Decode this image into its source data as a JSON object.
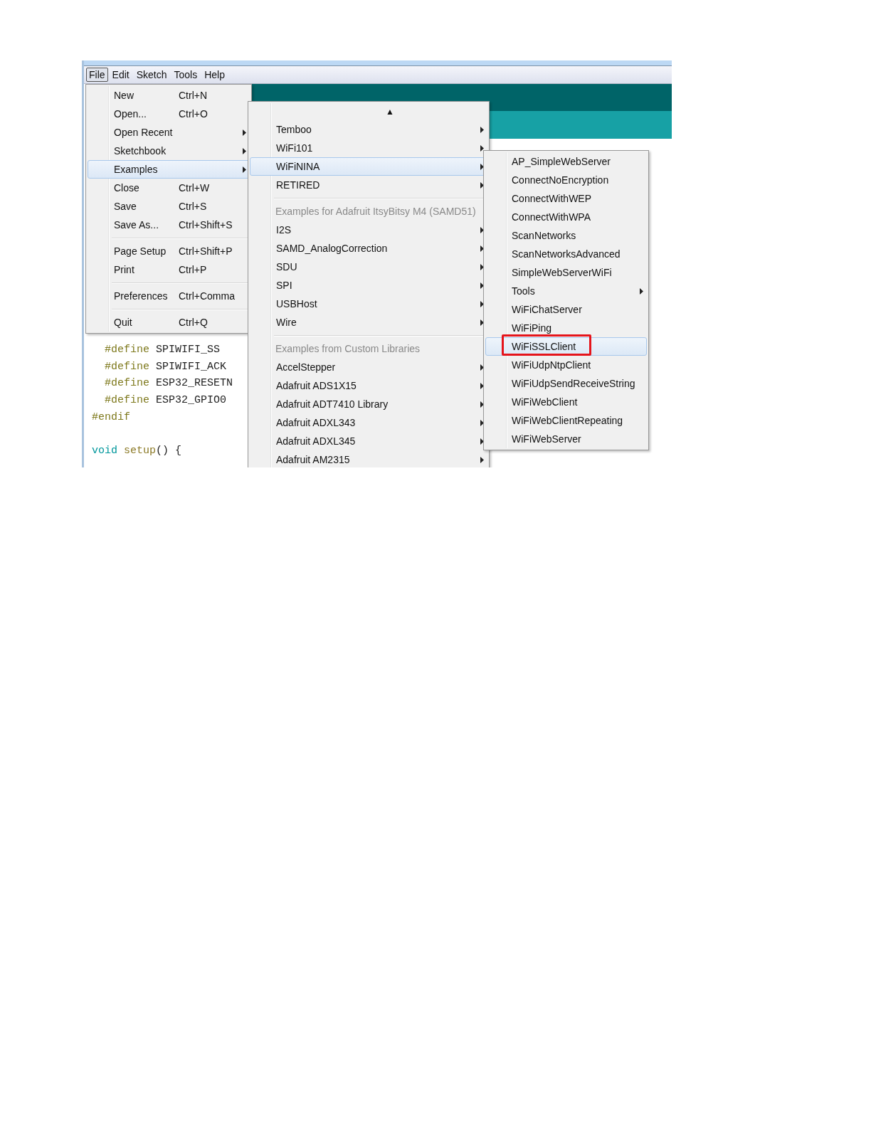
{
  "menu_bar": [
    {
      "label": "File",
      "selected": true
    },
    {
      "label": "Edit",
      "selected": false
    },
    {
      "label": "Sketch",
      "selected": false
    },
    {
      "label": "Tools",
      "selected": false
    },
    {
      "label": "Help",
      "selected": false
    }
  ],
  "code_lines": [
    {
      "tokens": [
        {
          "text": "  #define",
          "kind": "directive"
        },
        {
          "text": " SPIWIFI_SS",
          "kind": "plain"
        }
      ]
    },
    {
      "tokens": [
        {
          "text": "  #define",
          "kind": "directive"
        },
        {
          "text": " SPIWIFI_ACK",
          "kind": "plain"
        }
      ]
    },
    {
      "tokens": [
        {
          "text": "  #define",
          "kind": "directive"
        },
        {
          "text": " ESP32_RESETN",
          "kind": "plain"
        }
      ]
    },
    {
      "tokens": [
        {
          "text": "  #define",
          "kind": "directive"
        },
        {
          "text": " ESP32_GPIO0",
          "kind": "plain"
        }
      ]
    },
    {
      "tokens": [
        {
          "text": "#endif",
          "kind": "directive"
        }
      ]
    },
    {
      "kind": "blank"
    },
    {
      "tokens": [
        {
          "text": "void",
          "kind": "type"
        },
        {
          "text": " setup",
          "kind": "function"
        },
        {
          "text": "() {",
          "kind": "plain"
        }
      ]
    }
  ],
  "file_menu": [
    {
      "kind": "item",
      "label": "New",
      "shortcut": "Ctrl+N",
      "has_submenu": false,
      "selected": false
    },
    {
      "kind": "item",
      "label": "Open...",
      "shortcut": "Ctrl+O",
      "has_submenu": false,
      "selected": false
    },
    {
      "kind": "item",
      "label": "Open Recent",
      "has_submenu": true,
      "selected": false
    },
    {
      "kind": "item",
      "label": "Sketchbook",
      "has_submenu": true,
      "selected": false
    },
    {
      "kind": "item",
      "label": "Examples",
      "has_submenu": true,
      "selected": true
    },
    {
      "kind": "item",
      "label": "Close",
      "shortcut": "Ctrl+W",
      "has_submenu": false,
      "selected": false
    },
    {
      "kind": "item",
      "label": "Save",
      "shortcut": "Ctrl+S",
      "has_submenu": false,
      "selected": false
    },
    {
      "kind": "item",
      "label": "Save As...",
      "shortcut": "Ctrl+Shift+S",
      "has_submenu": false,
      "selected": false
    },
    {
      "kind": "separator"
    },
    {
      "kind": "item",
      "label": "Page Setup",
      "shortcut": "Ctrl+Shift+P",
      "has_submenu": false,
      "selected": false
    },
    {
      "kind": "item",
      "label": "Print",
      "shortcut": "Ctrl+P",
      "has_submenu": false,
      "selected": false
    },
    {
      "kind": "separator"
    },
    {
      "kind": "item",
      "label": "Preferences",
      "shortcut": "Ctrl+Comma",
      "has_submenu": false,
      "selected": false
    },
    {
      "kind": "separator"
    },
    {
      "kind": "item",
      "label": "Quit",
      "shortcut": "Ctrl+Q",
      "has_submenu": false,
      "selected": false
    }
  ],
  "examples_menu": {
    "scroll_arrow": "▲",
    "items": [
      {
        "kind": "item",
        "label": "Temboo",
        "has_submenu": true,
        "selected": false
      },
      {
        "kind": "item",
        "label": "WiFi101",
        "has_submenu": true,
        "selected": false
      },
      {
        "kind": "item",
        "label": "WiFiNINA",
        "has_submenu": true,
        "selected": true
      },
      {
        "kind": "item",
        "label": "RETIRED",
        "has_submenu": true,
        "selected": false
      },
      {
        "kind": "separator"
      },
      {
        "kind": "header",
        "label": "Examples for Adafruit ItsyBitsy M4 (SAMD51)"
      },
      {
        "kind": "item",
        "label": "I2S",
        "has_submenu": true,
        "selected": false
      },
      {
        "kind": "item",
        "label": "SAMD_AnalogCorrection",
        "has_submenu": true,
        "selected": false
      },
      {
        "kind": "item",
        "label": "SDU",
        "has_submenu": true,
        "selected": false
      },
      {
        "kind": "item",
        "label": "SPI",
        "has_submenu": true,
        "selected": false
      },
      {
        "kind": "item",
        "label": "USBHost",
        "has_submenu": true,
        "selected": false
      },
      {
        "kind": "item",
        "label": "Wire",
        "has_submenu": true,
        "selected": false
      },
      {
        "kind": "separator"
      },
      {
        "kind": "header",
        "label": "Examples from Custom Libraries"
      },
      {
        "kind": "item",
        "label": "AccelStepper",
        "has_submenu": true,
        "selected": false
      },
      {
        "kind": "item",
        "label": "Adafruit ADS1X15",
        "has_submenu": true,
        "selected": false
      },
      {
        "kind": "item",
        "label": "Adafruit ADT7410 Library",
        "has_submenu": true,
        "selected": false
      },
      {
        "kind": "item",
        "label": "Adafruit ADXL343",
        "has_submenu": true,
        "selected": false
      },
      {
        "kind": "item",
        "label": "Adafruit ADXL345",
        "has_submenu": true,
        "selected": false
      },
      {
        "kind": "item",
        "label": "Adafruit AM2315",
        "has_submenu": true,
        "selected": false
      }
    ]
  },
  "wifinina_menu": [
    {
      "kind": "item",
      "label": "AP_SimpleWebServer",
      "has_submenu": false,
      "selected": false,
      "highlighted": false
    },
    {
      "kind": "item",
      "label": "ConnectNoEncryption",
      "has_submenu": false,
      "selected": false,
      "highlighted": false
    },
    {
      "kind": "item",
      "label": "ConnectWithWEP",
      "has_submenu": false,
      "selected": false,
      "highlighted": false
    },
    {
      "kind": "item",
      "label": "ConnectWithWPA",
      "has_submenu": false,
      "selected": false,
      "highlighted": false
    },
    {
      "kind": "item",
      "label": "ScanNetworks",
      "has_submenu": false,
      "selected": false,
      "highlighted": false
    },
    {
      "kind": "item",
      "label": "ScanNetworksAdvanced",
      "has_submenu": false,
      "selected": false,
      "highlighted": false
    },
    {
      "kind": "item",
      "label": "SimpleWebServerWiFi",
      "has_submenu": false,
      "selected": false,
      "highlighted": false
    },
    {
      "kind": "item",
      "label": "Tools",
      "has_submenu": true,
      "selected": false,
      "highlighted": false
    },
    {
      "kind": "item",
      "label": "WiFiChatServer",
      "has_submenu": false,
      "selected": false,
      "highlighted": false
    },
    {
      "kind": "item",
      "label": "WiFiPing",
      "has_submenu": false,
      "selected": false,
      "highlighted": false
    },
    {
      "kind": "item",
      "label": "WiFiSSLClient",
      "has_submenu": false,
      "selected": true,
      "highlighted": true
    },
    {
      "kind": "item",
      "label": "WiFiUdpNtpClient",
      "has_submenu": false,
      "selected": false,
      "highlighted": false
    },
    {
      "kind": "item",
      "label": "WiFiUdpSendReceiveString",
      "has_submenu": false,
      "selected": false,
      "highlighted": false
    },
    {
      "kind": "item",
      "label": "WiFiWebClient",
      "has_submenu": false,
      "selected": false,
      "highlighted": false
    },
    {
      "kind": "item",
      "label": "WiFiWebClientRepeating",
      "has_submenu": false,
      "selected": false,
      "highlighted": false
    },
    {
      "kind": "item",
      "label": "WiFiWebServer",
      "has_submenu": false,
      "selected": false,
      "highlighted": false
    }
  ]
}
